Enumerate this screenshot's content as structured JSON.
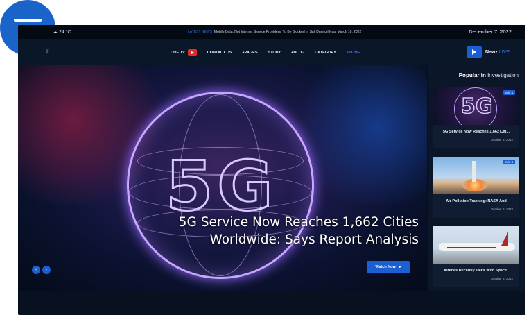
{
  "fab": {
    "icon": "menu-icon"
  },
  "topbar": {
    "weather": "24 °C",
    "ticker_label": "LATEST NEWS",
    "ticker_text": "Mobile Data, Not Internet Service Providers, To Be Blocked In Sali During Hyapi March 10, 2022",
    "date": "December 7, 2022"
  },
  "nav": {
    "items": [
      "LIVE TV",
      "CONTACT US",
      "+PAGES",
      "STORY",
      "+BLOG",
      "CATEGORY",
      "+HOME"
    ],
    "brand": "Newz",
    "brand_live": "LIVE"
  },
  "hero": {
    "bg_text": "5G",
    "headline_1": "5G Service Now Reaches 1,662 Cities",
    "headline_2": "Worldwide: Says Report Analysis",
    "watch_label": "Watch Now",
    "prev": "‹",
    "next": "›"
  },
  "sidebar": {
    "title_bold": "Popular In",
    "title_rest": "Investigation",
    "cards": [
      {
        "tag": "min 4",
        "title": "5G Service Now Reaches 1,662 Citi...",
        "date": "October 6, 2022",
        "thumb_text": "5G"
      },
      {
        "tag": "min 4",
        "title": "Air Pollution Tracking: NASA And",
        "date": "October 6, 2022"
      },
      {
        "tag": "",
        "title": "Airlines Recently Talks With Space..",
        "date": "October 6, 2022"
      }
    ]
  },
  "colors": {
    "accent": "#1b5fd3",
    "background": "#06101d",
    "live_red": "#e12b2b"
  }
}
